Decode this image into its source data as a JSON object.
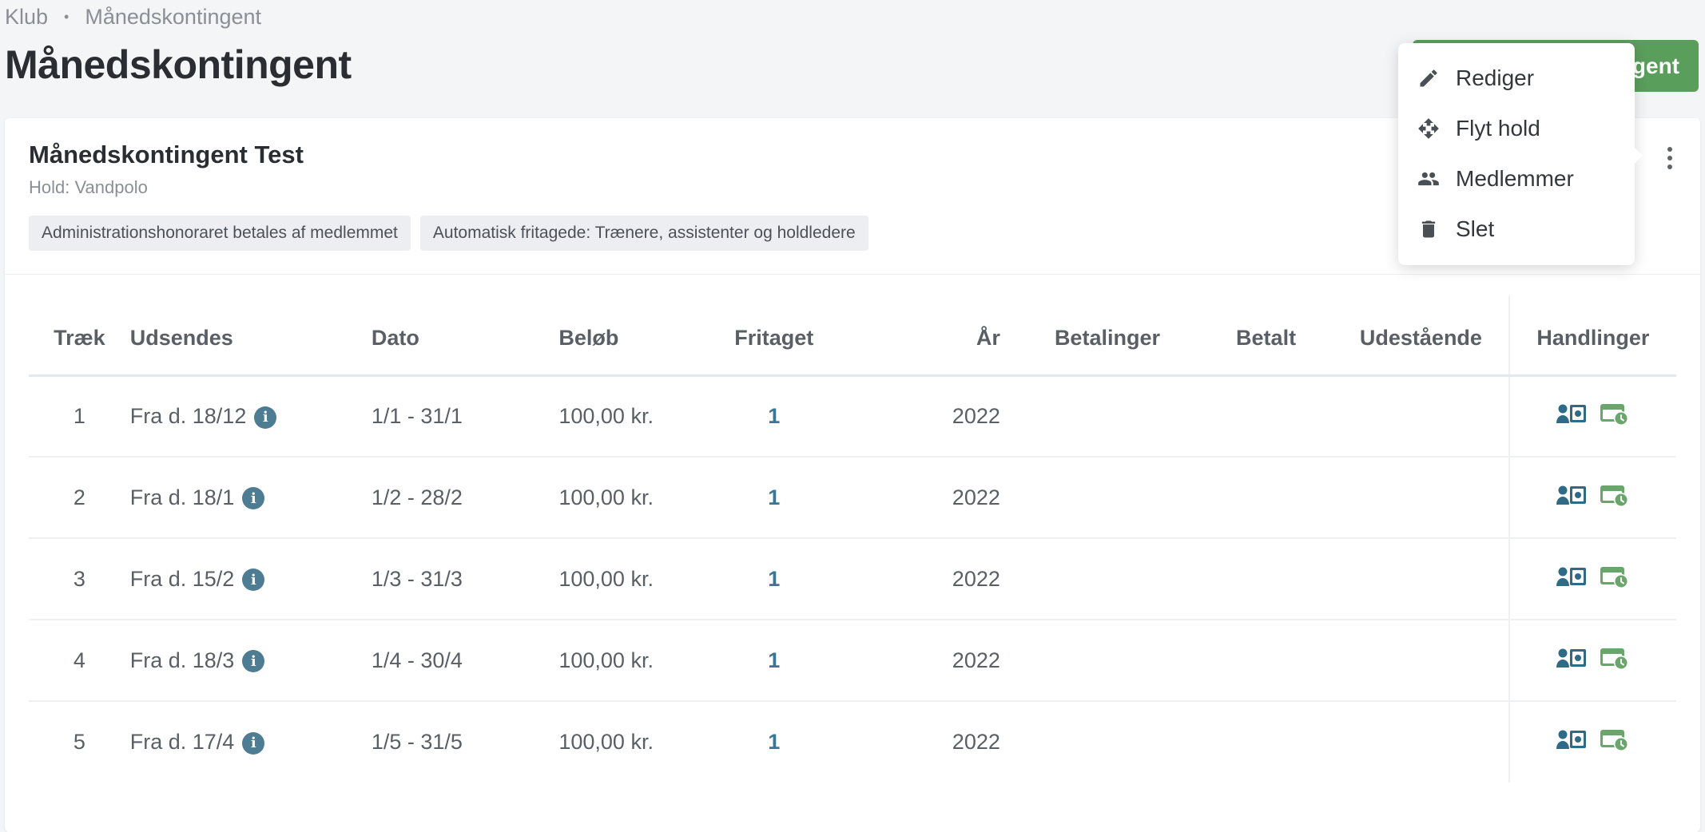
{
  "breadcrumb": {
    "items": [
      "Klub",
      "Månedskontingent"
    ],
    "separator": "•"
  },
  "page_title": "Månedskontingent",
  "primary_button_label": "gent",
  "card": {
    "title": "Månedskontingent Test",
    "subtitle": "Hold: Vandpolo",
    "tags": [
      "Administrationshonoraret betales af medlemmet",
      "Automatisk fritagede: Trænere, assistenter og holdledere"
    ]
  },
  "table": {
    "headers": {
      "traek": "Træk",
      "udsendes": "Udsendes",
      "dato": "Dato",
      "beloeb": "Beløb",
      "fritaget": "Fritaget",
      "aar": "År",
      "betalinger": "Betalinger",
      "betalt": "Betalt",
      "udestaaende": "Udestående",
      "handlinger": "Handlinger"
    },
    "rows": [
      {
        "traek": "1",
        "udsendes": "Fra d. 18/12",
        "dato": "1/1 - 31/1",
        "beloeb": "100,00 kr.",
        "fritaget": "1",
        "aar": "2022",
        "betalinger": "",
        "betalt": "",
        "udestaaende": ""
      },
      {
        "traek": "2",
        "udsendes": "Fra d. 18/1",
        "dato": "1/2 - 28/2",
        "beloeb": "100,00 kr.",
        "fritaget": "1",
        "aar": "2022",
        "betalinger": "",
        "betalt": "",
        "udestaaende": ""
      },
      {
        "traek": "3",
        "udsendes": "Fra d. 15/2",
        "dato": "1/3 - 31/3",
        "beloeb": "100,00 kr.",
        "fritaget": "1",
        "aar": "2022",
        "betalinger": "",
        "betalt": "",
        "udestaaende": ""
      },
      {
        "traek": "4",
        "udsendes": "Fra d. 18/3",
        "dato": "1/4 - 30/4",
        "beloeb": "100,00 kr.",
        "fritaget": "1",
        "aar": "2022",
        "betalinger": "",
        "betalt": "",
        "udestaaende": ""
      },
      {
        "traek": "5",
        "udsendes": "Fra d. 17/4",
        "dato": "1/5 - 31/5",
        "beloeb": "100,00 kr.",
        "fritaget": "1",
        "aar": "2022",
        "betalinger": "",
        "betalt": "",
        "udestaaende": ""
      }
    ]
  },
  "menu": {
    "items": [
      {
        "label": "Rediger",
        "icon": "pencil-icon"
      },
      {
        "label": "Flyt hold",
        "icon": "move-icon"
      },
      {
        "label": "Medlemmer",
        "icon": "people-icon"
      },
      {
        "label": "Slet",
        "icon": "trash-icon"
      }
    ]
  },
  "colors": {
    "primary_green": "#5a9e5c",
    "link_blue": "#3a7694",
    "icon_blue": "#2f6a86",
    "icon_green": "#6aa56b"
  }
}
